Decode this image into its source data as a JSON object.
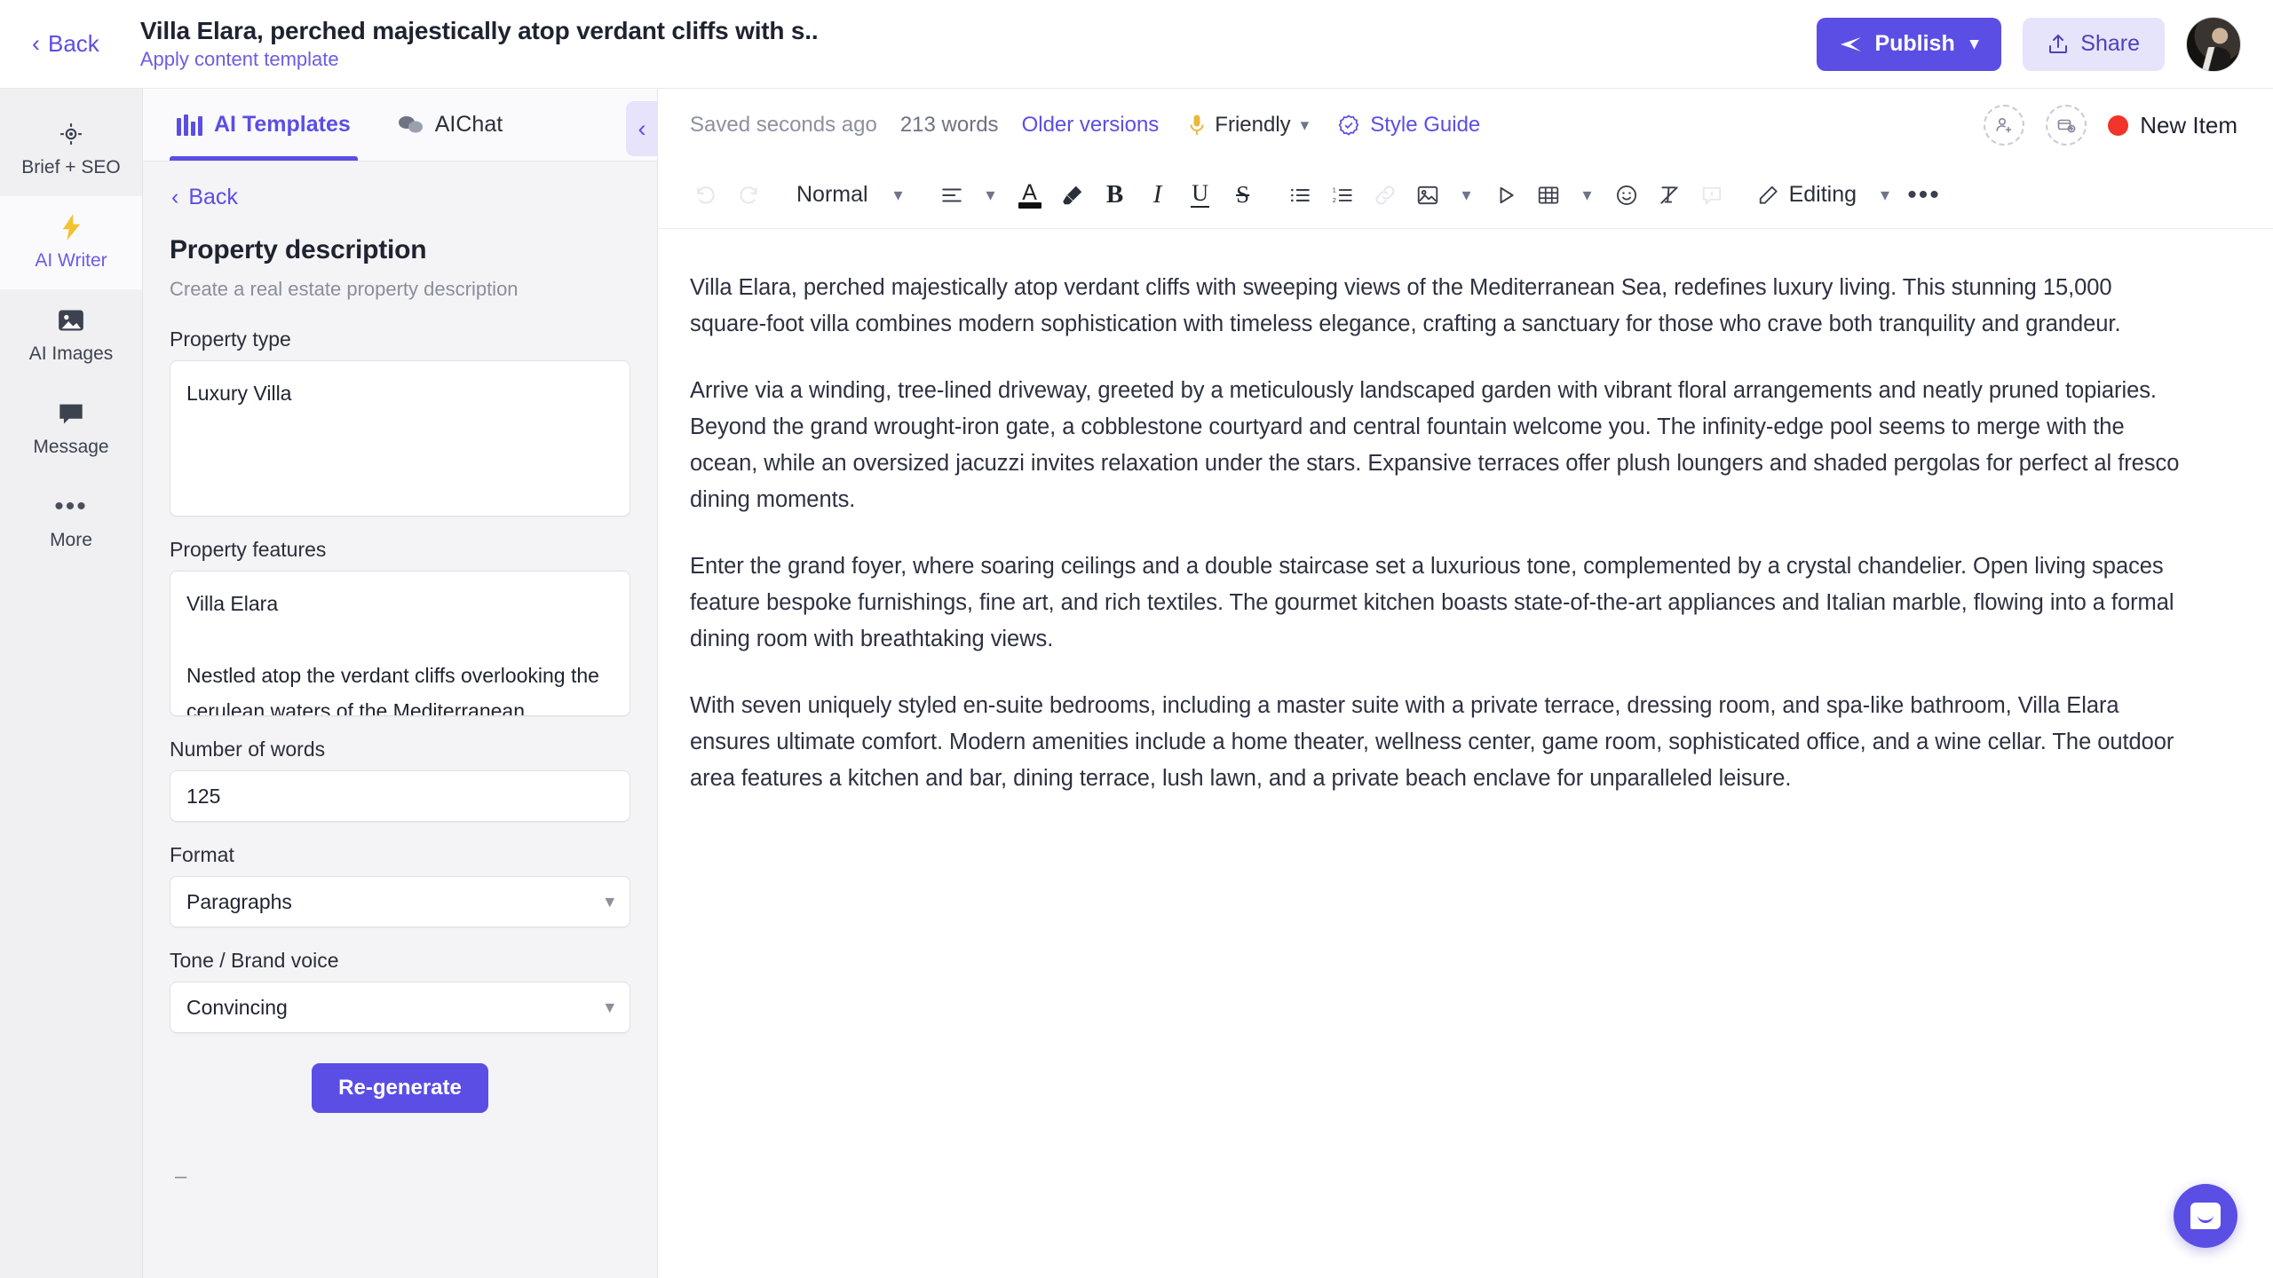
{
  "topbar": {
    "back_label": "Back",
    "doc_title": "Villa Elara, perched majestically atop verdant cliffs with s..",
    "apply_template_label": "Apply content template",
    "publish_label": "Publish",
    "share_label": "Share"
  },
  "rail": {
    "items": [
      {
        "label": "Brief + SEO",
        "icon": "target-icon",
        "active": false
      },
      {
        "label": "AI Writer",
        "icon": "lightning-icon",
        "active": true
      },
      {
        "label": "AI Images",
        "icon": "image-icon",
        "active": false
      },
      {
        "label": "Message",
        "icon": "chat-bubble-icon",
        "active": false
      },
      {
        "label": "More",
        "icon": "ellipsis-icon",
        "active": false
      }
    ]
  },
  "panel": {
    "tabs": [
      {
        "label": "AI Templates",
        "icon": "templates-bars-icon",
        "active": true
      },
      {
        "label": "AIChat",
        "icon": "chat-bubbles-icon",
        "active": false
      }
    ],
    "back_label": "Back",
    "title": "Property description",
    "subtitle": "Create a real estate property description",
    "fields": {
      "property_type": {
        "label": "Property type",
        "value": "Luxury Villa"
      },
      "property_features": {
        "label": "Property features",
        "value": "Villa Elara\n\nNestled atop the verdant cliffs overlooking the cerulean waters of the Mediterranean"
      },
      "number_of_words": {
        "label": "Number of words",
        "value": "125"
      },
      "format": {
        "label": "Format",
        "value": "Paragraphs"
      },
      "tone": {
        "label": "Tone / Brand voice",
        "value": "Convincing"
      }
    },
    "regenerate_label": "Re-generate",
    "footer_dash": "–"
  },
  "editor": {
    "status": {
      "saved": "Saved seconds ago",
      "words": "213 words",
      "older_versions": "Older versions",
      "tone": "Friendly",
      "style_guide": "Style Guide",
      "new_item": "New Item",
      "invite_icon": "add-person-icon",
      "snapshot_icon": "add-card-icon",
      "status_color": "#f2342a"
    },
    "toolbar": {
      "undo": "undo-icon",
      "redo": "redo-icon",
      "paragraph_style": "Normal",
      "align": "align-left-icon",
      "font_color": "font-color-icon",
      "highlight": "highlighter-icon",
      "bold": "B",
      "italic": "I",
      "underline": "U",
      "strikethrough": "S",
      "bullet_list": "bullet-list-icon",
      "numbered_list": "numbered-list-icon",
      "link": "link-icon",
      "image": "image-icon",
      "media": "play-icon",
      "table": "table-icon",
      "emoji": "emoji-icon",
      "clear_format": "clear-format-icon",
      "comment": "comment-icon",
      "mode": "Editing",
      "more": "ellipsis-icon"
    },
    "document": {
      "paragraphs": [
        "Villa Elara, perched majestically atop verdant cliffs with sweeping views of the Mediterranean Sea, redefines luxury living. This stunning 15,000 square-foot villa combines modern sophistication with timeless elegance, crafting a sanctuary for those who crave both tranquility and grandeur.",
        "Arrive via a winding, tree-lined driveway, greeted by a meticulously landscaped garden with vibrant floral arrangements and neatly pruned topiaries. Beyond the grand wrought-iron gate, a cobblestone courtyard and central fountain welcome you. The infinity-edge pool seems to merge with the ocean, while an oversized jacuzzi invites relaxation under the stars. Expansive terraces offer plush loungers and shaded pergolas for perfect al fresco dining moments.",
        "Enter the grand foyer, where soaring ceilings and a double staircase set a luxurious tone, complemented by a crystal chandelier. Open living spaces feature bespoke furnishings, fine art, and rich textiles. The gourmet kitchen boasts state-of-the-art appliances and Italian marble, flowing into a formal dining room with breathtaking views.",
        "With seven uniquely styled en-suite bedrooms, including a master suite with a private terrace, dressing room, and spa-like bathroom, Villa Elara ensures ultimate comfort. Modern amenities include a home theater, wellness center, game room, sophisticated office, and a wine cellar. The outdoor area features a kitchen and bar, dining terrace, lush lawn, and a private beach enclave for unparalleled leisure."
      ]
    }
  },
  "widgets": {
    "intercom": "intercom-chat-icon"
  },
  "colors": {
    "accent": "#5b4ee5",
    "accent_soft": "#e6e4fb",
    "status_red": "#f2342a",
    "text": "#1f2330",
    "muted": "#8d90a0"
  }
}
